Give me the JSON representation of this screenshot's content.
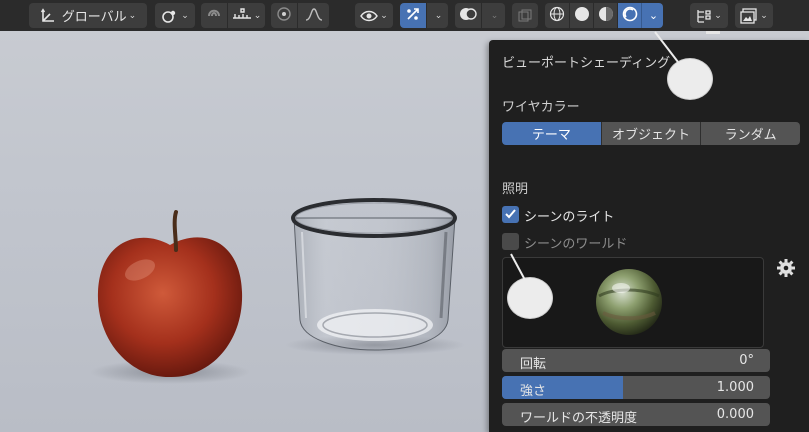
{
  "header": {
    "transform_orientation": "グローバル",
    "tools": [
      "transform-axes-icon",
      "pivot-icon",
      "snap-magnet-icon",
      "snap-increment-icon",
      "proportional-edit-icon",
      "falloff-curve-icon",
      "visibility-eye-icon",
      "gizmo-icon",
      "overlay-icon",
      "xray-icon",
      "shading-wireframe-icon",
      "shading-solid-icon",
      "shading-material-icon",
      "shading-rendered-icon",
      "outliner-filter-icon",
      "image-editor-icon"
    ]
  },
  "panel": {
    "title": "ビューポートシェーディング",
    "wire_color": {
      "label": "ワイヤカラー",
      "options": [
        "テーマ",
        "オブジェクト",
        "ランダム"
      ],
      "selected": "テーマ"
    },
    "lighting": {
      "label": "照明",
      "scene_lights": {
        "label": "シーンのライト",
        "checked": true
      },
      "scene_world": {
        "label": "シーンのワールド",
        "checked": false
      }
    },
    "fields": {
      "rotation": {
        "label": "回転",
        "value": "0°"
      },
      "strength": {
        "label": "強さ",
        "value": "1.000",
        "fill": 0.45
      },
      "world_opacity": {
        "label": "ワールドの不透明度",
        "value": "0.000"
      }
    }
  },
  "colors": {
    "accent": "#4772b3",
    "panel_bg": "#1f1f1f",
    "header_bg": "#2b2b2b",
    "button_bg": "#3d3d3d",
    "apple": "#a8321e",
    "viewport": "#c3c7ce"
  }
}
